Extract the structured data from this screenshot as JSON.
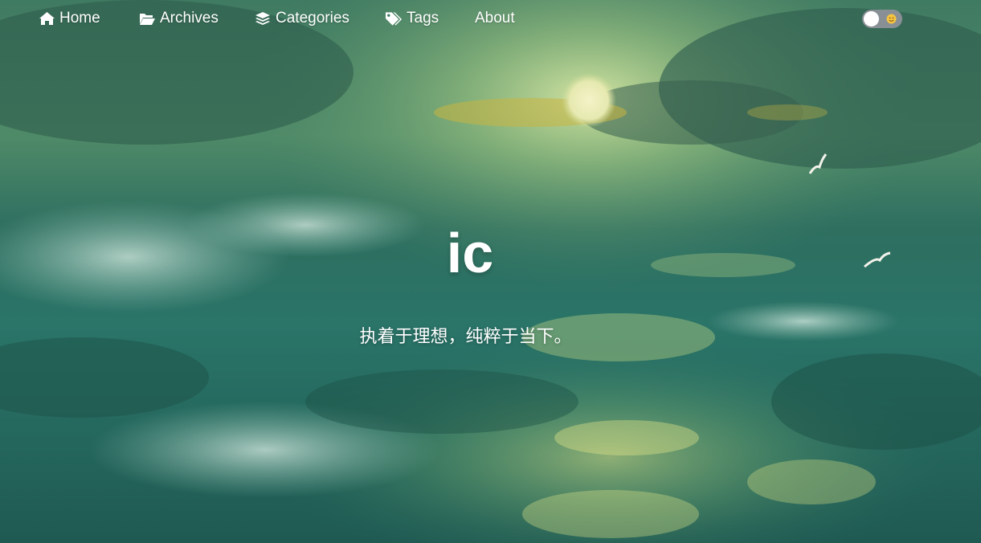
{
  "nav": {
    "items": [
      {
        "label": "Home",
        "icon": "home-icon"
      },
      {
        "label": "Archives",
        "icon": "folder-open-icon"
      },
      {
        "label": "Categories",
        "icon": "layers-icon"
      },
      {
        "label": "Tags",
        "icon": "tags-icon"
      },
      {
        "label": "About",
        "icon": ""
      }
    ]
  },
  "theme_toggle": {
    "state": "light",
    "icon": "sun-icon"
  },
  "hero": {
    "title": "ic",
    "subtitle": "执着于理想，纯粹于当下。",
    "background": "ocean-waves-painting"
  },
  "colors": {
    "text": "#ffffff",
    "toggle_track": "#9696a0",
    "sun": "#f4c542"
  }
}
